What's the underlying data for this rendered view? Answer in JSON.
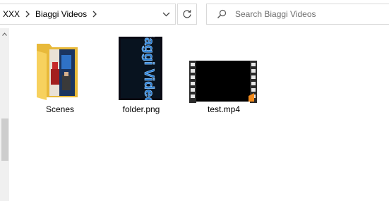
{
  "address_bar": {
    "breadcrumbs": [
      {
        "label": "XXX"
      },
      {
        "label": "Biaggi Videos"
      }
    ]
  },
  "search": {
    "placeholder": "Search Biaggi Videos"
  },
  "files": [
    {
      "name": "Scenes",
      "kind": "folder"
    },
    {
      "name": "folder.png",
      "kind": "image"
    },
    {
      "name": "test.mp4",
      "kind": "video"
    }
  ],
  "thumbnail_text": "Biaggi Videos",
  "colors": {
    "folder_yellow": "#f7d15e",
    "folder_back": "#e8b93a",
    "border": "#d9d9d9",
    "scrollbar_track": "#f0f0f0",
    "scrollbar_thumb": "#cdcdcd",
    "thumbnail_blue": "#2a7fd4",
    "video_accent": "#f28a1c"
  }
}
